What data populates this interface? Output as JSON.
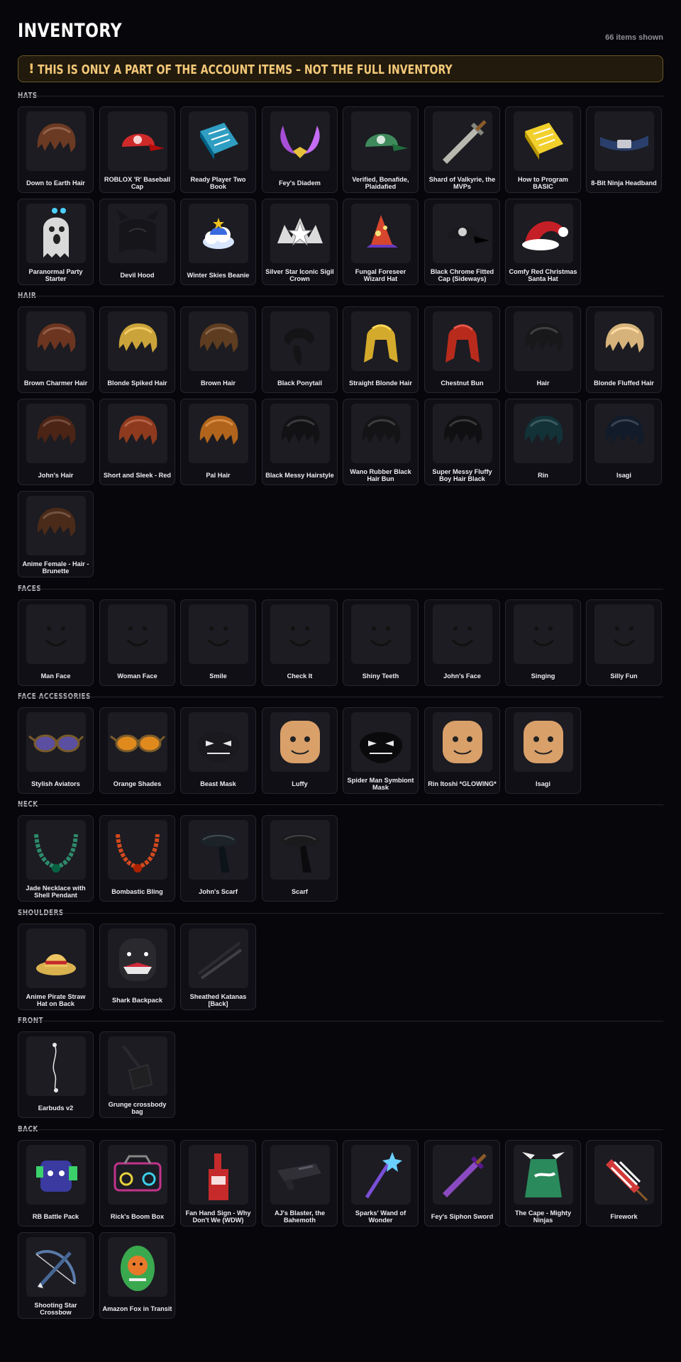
{
  "header": {
    "title": "INVENTORY",
    "count": "66 items shown"
  },
  "banner": {
    "icon": "!",
    "text": "THIS IS ONLY A PART OF THE ACCOUNT ITEMS – NOT THE FULL INVENTORY"
  },
  "sections": [
    {
      "label": "HATS",
      "items": [
        {
          "name": "Down to Earth Hair",
          "icon": "hair-icon",
          "color": "#6b3a22"
        },
        {
          "name": "ROBLOX 'R' Baseball Cap",
          "icon": "cap-icon",
          "color": "#cf2a2a"
        },
        {
          "name": "Ready Player Two Book",
          "icon": "book-icon",
          "color": "#2f9ec2"
        },
        {
          "name": "Fey's Diadem",
          "icon": "horns-icon",
          "color": "#a64fd6"
        },
        {
          "name": "Verified, Bonafide, Plaidafied",
          "icon": "cap-icon",
          "color": "#3f8a5c"
        },
        {
          "name": "Shard of Valkyrie, the MVPs",
          "icon": "sword-icon",
          "color": "#b8b8b0"
        },
        {
          "name": "How to Program BASIC",
          "icon": "book-icon",
          "color": "#f2d02c"
        },
        {
          "name": "8-Bit Ninja Headband",
          "icon": "headband-icon",
          "color": "#2a3f6b"
        },
        {
          "name": "Paranormal Party Starter",
          "icon": "ghost-icon",
          "color": "#d9d9d9"
        },
        {
          "name": "Devil Hood",
          "icon": "hood-icon",
          "color": "#15151a"
        },
        {
          "name": "Winter Skies Beanie",
          "icon": "cloud-icon",
          "color": "#d8e6ff"
        },
        {
          "name": "Silver Star Iconic Sigil Crown",
          "icon": "crown-icon",
          "color": "#dcdcdc"
        },
        {
          "name": "Fungal Foreseer Wizard Hat",
          "icon": "wizard-hat-icon",
          "color": "#d6462e"
        },
        {
          "name": "Black Chrome Fitted Cap (Sideways)",
          "icon": "cap-icon",
          "color": "#1a1a1e"
        },
        {
          "name": "Comfy Red Christmas Santa Hat",
          "icon": "santa-hat-icon",
          "color": "#c41f26"
        }
      ]
    },
    {
      "label": "HAIR",
      "items": [
        {
          "name": "Brown Charmer Hair",
          "icon": "hair-icon",
          "color": "#6b3520"
        },
        {
          "name": "Blonde Spiked Hair",
          "icon": "hair-icon",
          "color": "#caa33a"
        },
        {
          "name": "Brown Hair",
          "icon": "hair-icon",
          "color": "#5e3c20"
        },
        {
          "name": "Black Ponytail",
          "icon": "ponytail-icon",
          "color": "#141417"
        },
        {
          "name": "Straight Blonde Hair",
          "icon": "long-hair-icon",
          "color": "#d4aa2c"
        },
        {
          "name": "Chestnut Bun",
          "icon": "long-hair-icon",
          "color": "#b82b1c"
        },
        {
          "name": "Hair",
          "icon": "hair-icon",
          "color": "#18181b"
        },
        {
          "name": "Blonde Fluffed Hair",
          "icon": "hair-icon",
          "color": "#d6b37a"
        },
        {
          "name": "John's Hair",
          "icon": "hair-icon",
          "color": "#4b2416"
        },
        {
          "name": "Short and Sleek - Red",
          "icon": "hair-icon",
          "color": "#8e3a1e"
        },
        {
          "name": "Pal Hair",
          "icon": "hair-icon",
          "color": "#b0641c"
        },
        {
          "name": "Black Messy Hairstyle",
          "icon": "hair-icon",
          "color": "#121214"
        },
        {
          "name": "Wano Rubber Black Hair Bun",
          "icon": "hair-icon",
          "color": "#141416"
        },
        {
          "name": "Super Messy Fluffy Boy Hair Black",
          "icon": "hair-icon",
          "color": "#101012"
        },
        {
          "name": "Rin",
          "icon": "hair-icon",
          "color": "#123238"
        },
        {
          "name": "Isagi",
          "icon": "hair-icon",
          "color": "#121b2a"
        },
        {
          "name": "Anime Female - Hair - Brunette",
          "icon": "hair-icon",
          "color": "#4a2a18"
        }
      ]
    },
    {
      "label": "FACES",
      "items": [
        {
          "name": "Man Face",
          "icon": "face-icon",
          "color": "#111111"
        },
        {
          "name": "Woman Face",
          "icon": "face-icon",
          "color": "#111111"
        },
        {
          "name": "Smile",
          "icon": "face-icon",
          "color": "#111111"
        },
        {
          "name": "Check It",
          "icon": "face-icon",
          "color": "#111111"
        },
        {
          "name": "Shiny Teeth",
          "icon": "face-icon",
          "color": "#111111"
        },
        {
          "name": "John's Face",
          "icon": "face-icon",
          "color": "#111111"
        },
        {
          "name": "Singing",
          "icon": "face-icon",
          "color": "#111111"
        },
        {
          "name": "Silly Fun",
          "icon": "face-icon",
          "color": "#111111"
        }
      ]
    },
    {
      "label": "FACE ACCESSORIES",
      "items": [
        {
          "name": "Stylish Aviators",
          "icon": "glasses-icon",
          "color": "#5a4fa0"
        },
        {
          "name": "Orange Shades",
          "icon": "glasses-icon",
          "color": "#e08a1e"
        },
        {
          "name": "Beast Mask",
          "icon": "mask-icon",
          "color": "#1a1a1e"
        },
        {
          "name": "Luffy",
          "icon": "head-icon",
          "color": "#d9a06a"
        },
        {
          "name": "Spider Man Symbiont Mask",
          "icon": "mask-icon",
          "color": "#0a0a0c"
        },
        {
          "name": "Rin Itoshi *GLOWING*",
          "icon": "head-icon",
          "color": "#d9a06a"
        },
        {
          "name": "Isagi",
          "icon": "head-icon",
          "color": "#d9a06a"
        }
      ]
    },
    {
      "label": "NECK",
      "items": [
        {
          "name": "Jade Necklace with Shell Pendant",
          "icon": "necklace-icon",
          "color": "#2e8a6a"
        },
        {
          "name": "Bombastic Bling",
          "icon": "necklace-icon",
          "color": "#d2491e"
        },
        {
          "name": "John's Scarf",
          "icon": "scarf-icon",
          "color": "#1b2228"
        },
        {
          "name": "Scarf",
          "icon": "scarf-icon",
          "color": "#1a1a1d"
        }
      ]
    },
    {
      "label": "SHOULDERS",
      "items": [
        {
          "name": "Anime Pirate Straw Hat on Back",
          "icon": "straw-hat-icon",
          "color": "#d9b14e"
        },
        {
          "name": "Shark Backpack",
          "icon": "backpack-icon",
          "color": "#2a2a2e"
        },
        {
          "name": "Sheathed Katanas [Back]",
          "icon": "katana-icon",
          "color": "#2c2c30"
        }
      ]
    },
    {
      "label": "FRONT",
      "items": [
        {
          "name": "Earbuds v2",
          "icon": "earbuds-icon",
          "color": "#e6e6e6"
        },
        {
          "name": "Grunge crossbody bag",
          "icon": "bag-icon",
          "color": "#111114"
        }
      ]
    },
    {
      "label": "BACK",
      "items": [
        {
          "name": "RB Battle Pack",
          "icon": "robot-icon",
          "color": "#3ad16a"
        },
        {
          "name": "Rick's Boom Box",
          "icon": "boombox-icon",
          "color": "#c2338a"
        },
        {
          "name": "Fan Hand Sign - Why Don't We (WDW)",
          "icon": "foam-hand-icon",
          "color": "#c62a2a"
        },
        {
          "name": "AJ's Blaster, the Bahemoth",
          "icon": "blaster-icon",
          "color": "#303036"
        },
        {
          "name": "Sparks' Wand of Wonder",
          "icon": "wand-icon",
          "color": "#7a4fd6"
        },
        {
          "name": "Fey's Siphon Sword",
          "icon": "sword-icon",
          "color": "#8a4ac0"
        },
        {
          "name": "The Cape - Mighty Ninjas",
          "icon": "cape-icon",
          "color": "#2a8a5c"
        },
        {
          "name": "Firework",
          "icon": "firework-icon",
          "color": "#d23a3a"
        },
        {
          "name": "Shooting Star Crossbow",
          "icon": "crossbow-icon",
          "color": "#5a7aa8"
        },
        {
          "name": "Amazon Fox in Transit",
          "icon": "fox-icon",
          "color": "#3aa84e"
        }
      ]
    }
  ]
}
